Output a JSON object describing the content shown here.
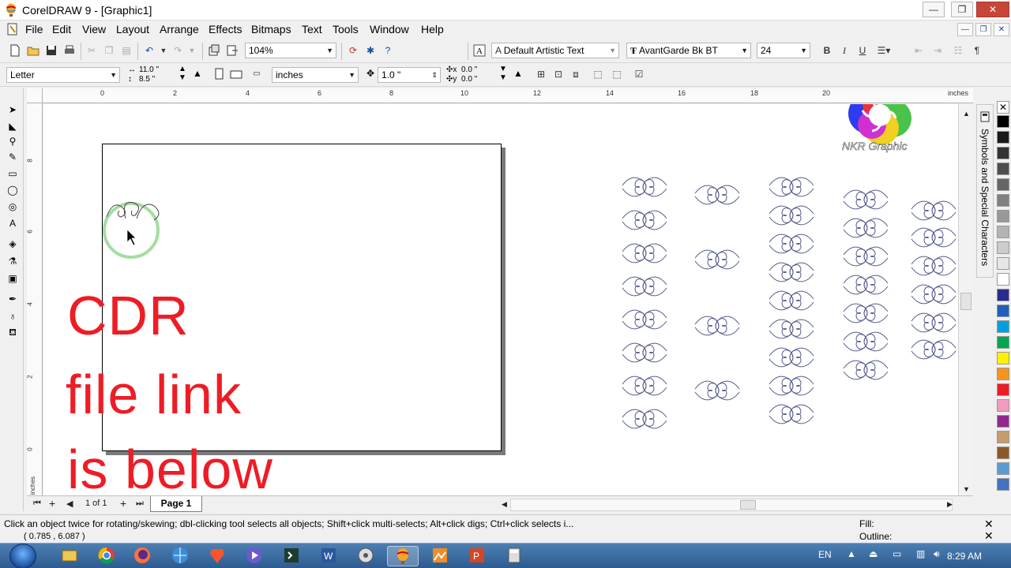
{
  "window": {
    "title": "CorelDRAW 9 - [Graphic1]",
    "controls": {
      "minimize": "—",
      "maximize": "❐",
      "close": "✕"
    }
  },
  "menubar": {
    "items": [
      "File",
      "Edit",
      "View",
      "Layout",
      "Arrange",
      "Effects",
      "Bitmaps",
      "Text",
      "Tools",
      "Window",
      "Help"
    ],
    "mdi_controls": {
      "minimize": "—",
      "restore": "❐",
      "close": "✕"
    }
  },
  "standard_toolbar": {
    "zoom_level": "104%",
    "text_style": "Default Artistic Text",
    "font_name": "AvantGarde Bk BT",
    "font_size": "24",
    "bold": "B",
    "italic": "I",
    "underline": "U",
    "paragraph": "¶"
  },
  "property_bar": {
    "paper_type": "Letter",
    "page_width": "11.0 \"",
    "page_height": "8.5 \"",
    "units": "inches",
    "nudge": "1.0 \"",
    "dup_x": "0.0 \"",
    "dup_y": "0.0 \""
  },
  "rulers": {
    "horizontal_labels": [
      "0",
      "2",
      "4",
      "6",
      "8",
      "10",
      "12",
      "14",
      "16",
      "18",
      "20"
    ],
    "horizontal_unit": "inches",
    "vertical_labels": [
      "8",
      "6",
      "4",
      "2",
      "0"
    ],
    "vertical_unit": "inches"
  },
  "canvas": {
    "overlay_text": [
      "CDR",
      "file link",
      "is below"
    ],
    "overlay_color": "#ee1c25",
    "logo_text": "NKR Graphic",
    "docker_title": "Symbols and Special Characters"
  },
  "page_navigator": {
    "page_count": "1 of 1",
    "active_page": "Page 1"
  },
  "status_bar": {
    "hint": "Click an object twice for rotating/skewing; dbl-clicking tool selects all objects; Shift+click multi-selects; Alt+click digs; Ctrl+click selects i...",
    "coordinates": "( 0.785 , 6.087 )",
    "fill_label": "Fill:",
    "outline_label": "Outline:"
  },
  "taskbar": {
    "language": "EN",
    "time": "8:29 AM"
  },
  "palette_colors": [
    "#000000",
    "#1a1a1a",
    "#333333",
    "#4d4d4d",
    "#666666",
    "#808080",
    "#999999",
    "#b3b3b3",
    "#cccccc",
    "#e6e6e6",
    "#ffffff",
    "#2b2b8f",
    "#1f5fbf",
    "#00a0e0",
    "#00a650",
    "#fff200",
    "#f7941d",
    "#ee1c25",
    "#f49ac1",
    "#92278f",
    "#c69c6d",
    "#8b5a2b",
    "#5b9bd5",
    "#4472c4"
  ]
}
